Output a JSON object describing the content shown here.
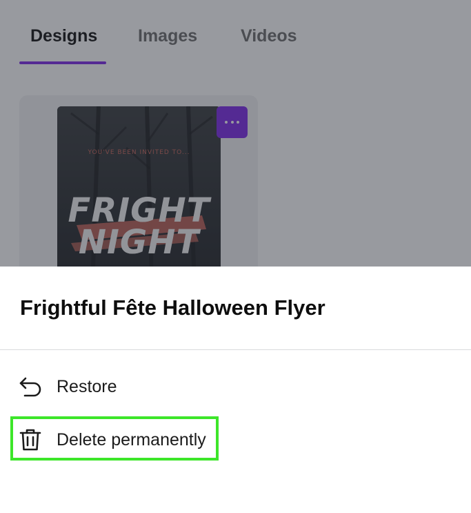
{
  "tabs": [
    {
      "label": "Designs",
      "active": true
    },
    {
      "label": "Images",
      "active": false
    },
    {
      "label": "Videos",
      "active": false
    }
  ],
  "card": {
    "thumbnail": {
      "invite_text": "YOU'VE BEEN INVITED TO...",
      "headline_line1": "FRIGHT",
      "headline_line2": "NIGHT"
    },
    "more_icon": "more-horizontal-icon"
  },
  "sheet": {
    "title": "Frightful Fête Halloween Flyer",
    "items": [
      {
        "label": "Restore",
        "icon": "undo-icon"
      },
      {
        "label": "Delete permanently",
        "icon": "trash-icon"
      }
    ]
  },
  "colors": {
    "accent": "#7d2ae8",
    "highlight": "#3de62a",
    "scrim": "rgba(40,44,55,0.48)",
    "thumbnail_accent": "#c8655a"
  }
}
